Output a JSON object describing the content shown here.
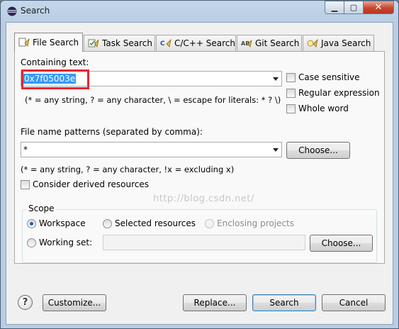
{
  "window": {
    "title": "Search"
  },
  "tabs": [
    {
      "label": "File Search",
      "icon": "file-search-icon",
      "active": true
    },
    {
      "label": "Task Search",
      "icon": "task-search-icon"
    },
    {
      "label": "C/C++ Search",
      "icon": "cpp-search-icon"
    },
    {
      "label": "Git Search",
      "icon": "git-search-icon"
    },
    {
      "label": "Java Search",
      "icon": "java-search-icon"
    }
  ],
  "containing_text": {
    "label": "Containing text:",
    "value": "0x7f05003e",
    "hint": "(* = any string, ? = any character, \\ = escape for literals: * ? \\)"
  },
  "options": {
    "case_sensitive": "Case sensitive",
    "regular_expression": "Regular expression",
    "whole_word": "Whole word"
  },
  "file_patterns": {
    "label": "File name patterns (separated by comma):",
    "value": "*",
    "choose_label": "Choose...",
    "hint": "(* = any string, ? = any character, !x = excluding x)"
  },
  "derived": {
    "label": "Consider derived resources"
  },
  "scope": {
    "title": "Scope",
    "workspace": "Workspace",
    "selected_resources": "Selected resources",
    "enclosing_projects": "Enclosing projects",
    "working_set": "Working set:",
    "working_set_value": "",
    "choose_label": "Choose..."
  },
  "watermark": "http://blog.csdn.net/",
  "footer": {
    "customize": "Customize...",
    "replace": "Replace...",
    "search": "Search",
    "cancel": "Cancel"
  }
}
